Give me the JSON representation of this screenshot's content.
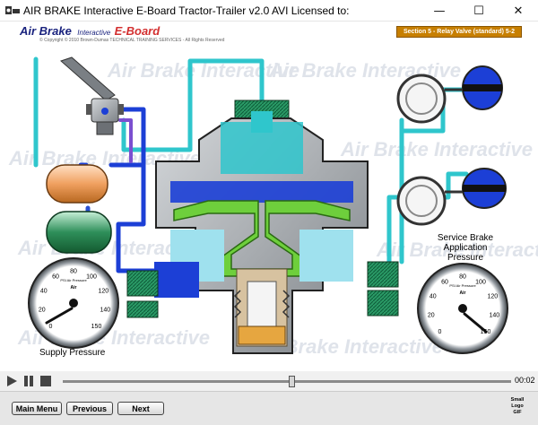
{
  "window": {
    "title": "AIR BRAKE Interactive E-Board Tractor-Trailer  v2.0 AVI    Licensed to:",
    "minimize_glyph": "—",
    "maximize_glyph": "☐",
    "close_glyph": "✕"
  },
  "stage": {
    "logo_part1": "Air Brake",
    "logo_part2": "Interactive",
    "logo_part3": "E-Board",
    "copyright": "© Copyright © 2010 Brown-Dumas TECHNICAL TRAINING SERVICES - All Rights Reserved",
    "section_badge": "Section 5 - Relay Valve (standard) 5-2",
    "watermark": "Air Brake Interactive",
    "supply_label": "Supply Pressure",
    "service_label": "Service Brake Application Pressure",
    "gauge_ticks": [
      "0",
      "20",
      "40",
      "60",
      "80",
      "100",
      "120",
      "140",
      "150"
    ],
    "gauge_caption": "PSI Air Pressure",
    "gauge_brand": "Air"
  },
  "player": {
    "progress": 0.51,
    "time": "00:02"
  },
  "nav": {
    "main_menu": "Main Menu",
    "previous": "Previous",
    "next": "Next",
    "small_logo_1": "Small",
    "small_logo_2": "Logo",
    "small_logo_3": "GIF"
  },
  "colors": {
    "supply_air": "#1c3fd6",
    "service_air": "#2fc6cc",
    "valve_body": "#8a8f95",
    "diaphragm": "#6ecf3c",
    "tank_orange": "#f0a060",
    "tank_green": "#2e8f5a",
    "port_green": "#2a9a66",
    "section_badge": "#c77f00"
  }
}
